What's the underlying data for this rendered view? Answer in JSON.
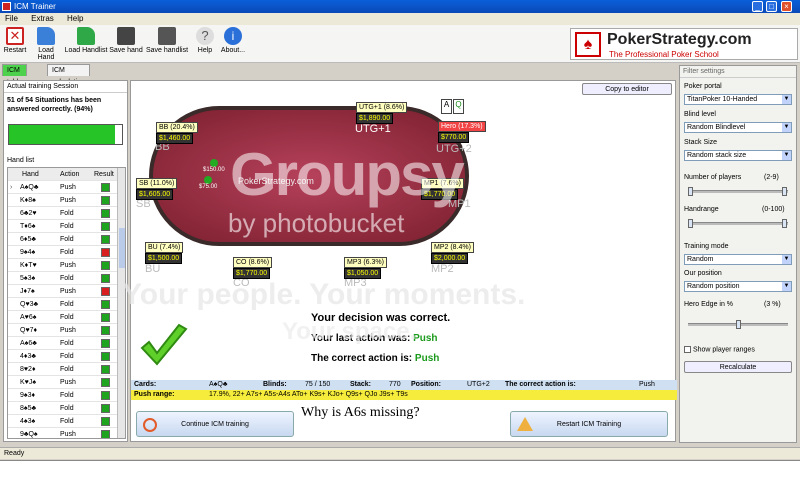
{
  "window": {
    "title": "ICM Trainer"
  },
  "menu": [
    "File",
    "Extras",
    "Help"
  ],
  "toolbar": {
    "restart": "Restart",
    "load_hand": "Load Hand",
    "load_handlist": "Load Handlist",
    "save_hand": "Save hand",
    "save_handlist": "Save handlist",
    "help": "Help",
    "about": "About..."
  },
  "logo": {
    "name": "PokerStrategy.com",
    "tagline": "The Professional Poker School"
  },
  "tabs": [
    "ICM table",
    "ICM calculation"
  ],
  "session": {
    "header": "Actual training Session",
    "summary": "51 of 54 Situations has been answered correctly. (94%)",
    "progress": 0.94
  },
  "handlist": {
    "label": "Hand list",
    "columns": [
      "Hand",
      "Action",
      "Result"
    ],
    "rows": [
      {
        "hand": "A♠Q♣",
        "action": "Push",
        "ok": true,
        "cur": true
      },
      {
        "hand": "K♦8♠",
        "action": "Push",
        "ok": true
      },
      {
        "hand": "6♣2♥",
        "action": "Fold",
        "ok": true
      },
      {
        "hand": "T♦6♠",
        "action": "Fold",
        "ok": true
      },
      {
        "hand": "6♦5♣",
        "action": "Fold",
        "ok": true
      },
      {
        "hand": "9♠4♠",
        "action": "Fold",
        "ok": false
      },
      {
        "hand": "K♦T♥",
        "action": "Push",
        "ok": true
      },
      {
        "hand": "5♠3♠",
        "action": "Fold",
        "ok": true
      },
      {
        "hand": "J♦7♠",
        "action": "Push",
        "ok": false
      },
      {
        "hand": "Q♥3♣",
        "action": "Fold",
        "ok": true
      },
      {
        "hand": "A♥6♠",
        "action": "Fold",
        "ok": true
      },
      {
        "hand": "Q♥7♦",
        "action": "Push",
        "ok": true
      },
      {
        "hand": "A♠6♣",
        "action": "Fold",
        "ok": true
      },
      {
        "hand": "4♦3♣",
        "action": "Fold",
        "ok": true
      },
      {
        "hand": "8♥2♦",
        "action": "Fold",
        "ok": true
      },
      {
        "hand": "K♥J♠",
        "action": "Push",
        "ok": true
      },
      {
        "hand": "9♠3♦",
        "action": "Fold",
        "ok": true
      },
      {
        "hand": "8♠5♣",
        "action": "Fold",
        "ok": true
      },
      {
        "hand": "4♠3♠",
        "action": "Fold",
        "ok": true
      },
      {
        "hand": "9♣Q♠",
        "action": "Push",
        "ok": true
      },
      {
        "hand": "9♥2♣",
        "action": "Fold",
        "ok": true
      }
    ]
  },
  "copy_to_editor": "Copy to editor",
  "seats": {
    "utg1": {
      "label": "UTG+1 (8.6%)",
      "stack": "$1,890.00",
      "pos": "UTG+1"
    },
    "hero": {
      "label": "Hero (17.3%)",
      "stack": "$770.00",
      "pos": "UTG+2"
    },
    "bb": {
      "label": "BB (20.4%)",
      "stack": "$1,460.00",
      "pos": "BB"
    },
    "sb": {
      "label": "SB (11.0%)",
      "stack": "$1,605.00",
      "pos": "SB"
    },
    "mp1": {
      "label": "MP1 (7.6%)",
      "stack": "$1,770.00",
      "pos": "MP1"
    },
    "bu": {
      "label": "BU (7.4%)",
      "stack": "$1,500.00",
      "pos": "BU"
    },
    "co": {
      "label": "CO (8.6%)",
      "stack": "$1,770.00",
      "pos": "CO"
    },
    "mp3": {
      "label": "MP3 (6.3%)",
      "stack": "$1,050.00",
      "pos": "MP3"
    },
    "mp2": {
      "label": "MP2 (8.4%)",
      "stack": "$2,000.00",
      "pos": "MP2"
    }
  },
  "pot_bb": "$150.00",
  "pot_sb": "$75.00",
  "table_brand": "PokerStrategy.com",
  "result": {
    "title": "Your decision was correct.",
    "last_label": "Your last action was:",
    "last_value": "Push",
    "correct_label": "The correct action is:",
    "correct_value": "Push"
  },
  "info": {
    "cards_label": "Cards:",
    "cards_value": "A♠Q♣",
    "blinds_label": "Blinds:",
    "blinds_value": "75 / 150",
    "stack_label": "Stack:",
    "stack_value": "770",
    "position_label": "Position:",
    "position_value": "UTG+2",
    "correct_label": "The correct action is:",
    "correct_value": "Push"
  },
  "range": {
    "label": "Push range:",
    "value": "17.9%, 22+ A7s+ A5s-A4s ATo+ K9s+ KJo+ Q9s+ QJo J9s+ T9s"
  },
  "buttons": {
    "continue": "Continue ICM training",
    "restart": "Restart ICM Training"
  },
  "annotation": "Why is A6s missing?",
  "filters": {
    "header": "Filter settings",
    "portal_label": "Poker portal",
    "portal_value": "TitanPoker 10-Handed",
    "blind_label": "Blind level",
    "blind_value": "Random Blindlevel",
    "stack_label": "Stack Size",
    "stack_value": "Random stack size",
    "players_label": "Number of players",
    "players_range": "(2-9)",
    "handrange_label": "Handrange",
    "handrange_range": "(0-100)",
    "mode_label": "Training mode",
    "mode_value": "Random",
    "pos_label": "Our position",
    "pos_value": "Random position",
    "edge_label": "Hero Edge in %",
    "edge_value": "(3 %)",
    "edge_level": 0.5,
    "show_ranges": "Show player ranges",
    "recalc": "Recalculate"
  },
  "status": "Ready",
  "watermark": {
    "brand": "Groupsy",
    "by": "by photobucket",
    "tag1": "Your people. Your moments.",
    "tag2": "Your space."
  },
  "colors": {
    "ok": "#1fa41f",
    "bad": "#d81e1e",
    "accent": "#0a5fd8"
  }
}
